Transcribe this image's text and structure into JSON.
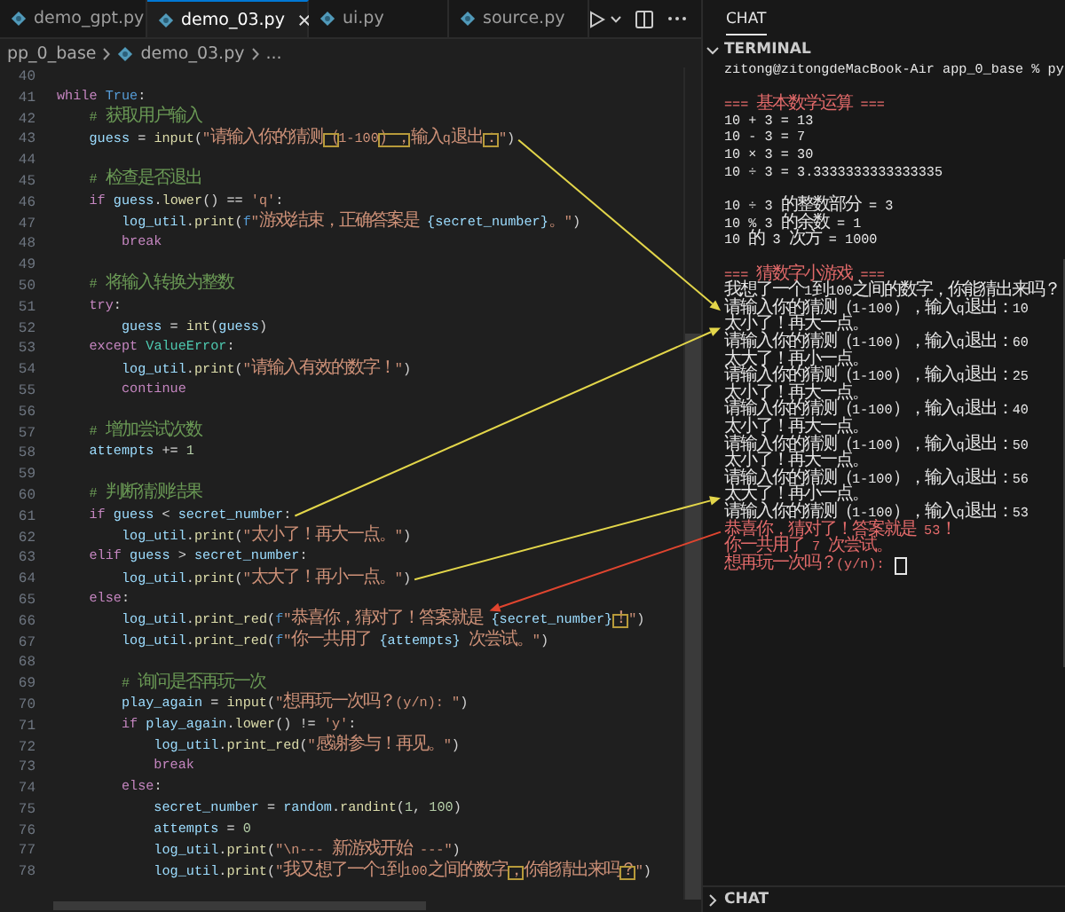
{
  "editor": {
    "tabs": [
      {
        "label": "demo_gpt.py",
        "selected": false
      },
      {
        "label": "demo_03.py",
        "selected": true
      },
      {
        "label": "ui.py",
        "selected": false
      },
      {
        "label": "source.py",
        "selected": false
      }
    ],
    "breadcrumb": [
      {
        "kind": "folder",
        "text": "pp_0_base"
      },
      {
        "kind": "file",
        "text": "demo_03.py"
      },
      {
        "kind": "more",
        "text": "..."
      }
    ],
    "lines": [
      {
        "number": "40"
      },
      {
        "number": "41",
        "tokens": [
          {
            "text": "while ",
            "kind": "keyword"
          },
          {
            "text": "True",
            "kind": "constant"
          },
          {
            "text": ":",
            "kind": "punct"
          }
        ]
      },
      {
        "number": "42",
        "tokens": [
          {
            "text": "    # 获取用户输入",
            "kind": "comment"
          }
        ]
      },
      {
        "number": "43",
        "tokens": [
          {
            "text": "    guess",
            "kind": "variable"
          },
          {
            "text": " = ",
            "kind": "punct"
          },
          {
            "text": "input",
            "kind": "function"
          },
          {
            "text": "(",
            "kind": "punct"
          },
          {
            "text": "\"请输入你的猜测",
            "kind": "string"
          },
          {
            "text": "（",
            "kind": "box"
          },
          {
            "text": "1-100",
            "kind": "string"
          },
          {
            "text": "），",
            "kind": "box"
          },
          {
            "text": "输入q退出",
            "kind": "string"
          },
          {
            "text": "：",
            "kind": "box"
          },
          {
            "text": "\"",
            "kind": "string"
          },
          {
            "text": ")",
            "kind": "punct"
          }
        ]
      },
      {
        "number": "44"
      },
      {
        "number": "45",
        "tokens": [
          {
            "text": "    # 检查是否退出",
            "kind": "comment"
          }
        ]
      },
      {
        "number": "46",
        "tokens": [
          {
            "text": "    if ",
            "kind": "keyword"
          },
          {
            "text": "guess",
            "kind": "variable"
          },
          {
            "text": ".",
            "kind": "punct"
          },
          {
            "text": "lower",
            "kind": "function"
          },
          {
            "text": "() == ",
            "kind": "punct"
          },
          {
            "text": "'q'",
            "kind": "string"
          },
          {
            "text": ":",
            "kind": "punct"
          }
        ]
      },
      {
        "number": "47",
        "tokens": [
          {
            "text": "        log_util",
            "kind": "variable"
          },
          {
            "text": ".",
            "kind": "punct"
          },
          {
            "text": "print",
            "kind": "function"
          },
          {
            "text": "(",
            "kind": "punct"
          },
          {
            "text": "f",
            "kind": "constant"
          },
          {
            "text": "\"游戏结束，正确答案是 ",
            "kind": "string"
          },
          {
            "text": "{secret_number}",
            "kind": "interp"
          },
          {
            "text": "。\"",
            "kind": "string"
          },
          {
            "text": ")",
            "kind": "punct"
          }
        ]
      },
      {
        "number": "48",
        "tokens": [
          {
            "text": "        break",
            "kind": "keyword"
          }
        ]
      },
      {
        "number": "49"
      },
      {
        "number": "50",
        "tokens": [
          {
            "text": "    # 将输入转换为整数",
            "kind": "comment"
          }
        ]
      },
      {
        "number": "51",
        "tokens": [
          {
            "text": "    try",
            "kind": "keyword"
          },
          {
            "text": ":",
            "kind": "punct"
          }
        ]
      },
      {
        "number": "52",
        "tokens": [
          {
            "text": "        guess",
            "kind": "variable"
          },
          {
            "text": " = ",
            "kind": "punct"
          },
          {
            "text": "int",
            "kind": "function"
          },
          {
            "text": "(",
            "kind": "punct"
          },
          {
            "text": "guess",
            "kind": "variable"
          },
          {
            "text": ")",
            "kind": "punct"
          }
        ]
      },
      {
        "number": "53",
        "tokens": [
          {
            "text": "    except ",
            "kind": "keyword"
          },
          {
            "text": "ValueError",
            "kind": "class"
          },
          {
            "text": ":",
            "kind": "punct"
          }
        ]
      },
      {
        "number": "54",
        "tokens": [
          {
            "text": "        log_util",
            "kind": "variable"
          },
          {
            "text": ".",
            "kind": "punct"
          },
          {
            "text": "print",
            "kind": "function"
          },
          {
            "text": "(",
            "kind": "punct"
          },
          {
            "text": "\"请输入有效的数字！\"",
            "kind": "string"
          },
          {
            "text": ")",
            "kind": "punct"
          }
        ]
      },
      {
        "number": "55",
        "tokens": [
          {
            "text": "        continue",
            "kind": "keyword"
          }
        ]
      },
      {
        "number": "56"
      },
      {
        "number": "57",
        "tokens": [
          {
            "text": "    # 增加尝试次数",
            "kind": "comment"
          }
        ]
      },
      {
        "number": "58",
        "tokens": [
          {
            "text": "    attempts",
            "kind": "variable"
          },
          {
            "text": " += ",
            "kind": "punct"
          },
          {
            "text": "1",
            "kind": "number"
          }
        ]
      },
      {
        "number": "59"
      },
      {
        "number": "60",
        "tokens": [
          {
            "text": "    # 判断猜测结果",
            "kind": "comment"
          }
        ]
      },
      {
        "number": "61",
        "tokens": [
          {
            "text": "    if ",
            "kind": "keyword"
          },
          {
            "text": "guess",
            "kind": "variable"
          },
          {
            "text": " < ",
            "kind": "punct"
          },
          {
            "text": "secret_number",
            "kind": "variable"
          },
          {
            "text": ":",
            "kind": "punct"
          }
        ]
      },
      {
        "number": "62",
        "tokens": [
          {
            "text": "        log_util",
            "kind": "variable"
          },
          {
            "text": ".",
            "kind": "punct"
          },
          {
            "text": "print",
            "kind": "function"
          },
          {
            "text": "(",
            "kind": "punct"
          },
          {
            "text": "\"太小了！再大一点。\"",
            "kind": "string"
          },
          {
            "text": ")",
            "kind": "punct"
          }
        ]
      },
      {
        "number": "63",
        "tokens": [
          {
            "text": "    elif ",
            "kind": "keyword"
          },
          {
            "text": "guess",
            "kind": "variable"
          },
          {
            "text": " > ",
            "kind": "punct"
          },
          {
            "text": "secret_number",
            "kind": "variable"
          },
          {
            "text": ":",
            "kind": "punct"
          }
        ]
      },
      {
        "number": "64",
        "tokens": [
          {
            "text": "        log_util",
            "kind": "variable"
          },
          {
            "text": ".",
            "kind": "punct"
          },
          {
            "text": "print",
            "kind": "function"
          },
          {
            "text": "(",
            "kind": "punct"
          },
          {
            "text": "\"太大了！再小一点。\"",
            "kind": "string"
          },
          {
            "text": ")",
            "kind": "punct"
          }
        ]
      },
      {
        "number": "65",
        "tokens": [
          {
            "text": "    else",
            "kind": "keyword"
          },
          {
            "text": ":",
            "kind": "punct"
          }
        ]
      },
      {
        "number": "66",
        "tokens": [
          {
            "text": "        log_util",
            "kind": "variable"
          },
          {
            "text": ".",
            "kind": "punct"
          },
          {
            "text": "print_red",
            "kind": "function"
          },
          {
            "text": "(",
            "kind": "punct"
          },
          {
            "text": "f",
            "kind": "constant"
          },
          {
            "text": "\"恭喜你，猜对了！答案就是 ",
            "kind": "string"
          },
          {
            "text": "{secret_number}",
            "kind": "interp"
          },
          {
            "text": "！",
            "kind": "box"
          },
          {
            "text": "\"",
            "kind": "string"
          },
          {
            "text": ")",
            "kind": "punct"
          }
        ]
      },
      {
        "number": "67",
        "tokens": [
          {
            "text": "        log_util",
            "kind": "variable"
          },
          {
            "text": ".",
            "kind": "punct"
          },
          {
            "text": "print_red",
            "kind": "function"
          },
          {
            "text": "(",
            "kind": "punct"
          },
          {
            "text": "f",
            "kind": "constant"
          },
          {
            "text": "\"你一共用了 ",
            "kind": "string"
          },
          {
            "text": "{attempts}",
            "kind": "interp"
          },
          {
            "text": " 次尝试。\"",
            "kind": "string"
          },
          {
            "text": ")",
            "kind": "punct"
          }
        ]
      },
      {
        "number": "68"
      },
      {
        "number": "69",
        "tokens": [
          {
            "text": "        # 询问是否再玩一次",
            "kind": "comment"
          }
        ]
      },
      {
        "number": "70",
        "tokens": [
          {
            "text": "        play_again",
            "kind": "variable"
          },
          {
            "text": " = ",
            "kind": "punct"
          },
          {
            "text": "input",
            "kind": "function"
          },
          {
            "text": "(",
            "kind": "punct"
          },
          {
            "text": "\"想再玩一次吗？(y/n): \"",
            "kind": "string"
          },
          {
            "text": ")",
            "kind": "punct"
          }
        ]
      },
      {
        "number": "71",
        "tokens": [
          {
            "text": "        if ",
            "kind": "keyword"
          },
          {
            "text": "play_again",
            "kind": "variable"
          },
          {
            "text": ".",
            "kind": "punct"
          },
          {
            "text": "lower",
            "kind": "function"
          },
          {
            "text": "() != ",
            "kind": "punct"
          },
          {
            "text": "'y'",
            "kind": "string"
          },
          {
            "text": ":",
            "kind": "punct"
          }
        ]
      },
      {
        "number": "72",
        "tokens": [
          {
            "text": "            log_util",
            "kind": "variable"
          },
          {
            "text": ".",
            "kind": "punct"
          },
          {
            "text": "print_red",
            "kind": "function"
          },
          {
            "text": "(",
            "kind": "punct"
          },
          {
            "text": "\"感谢参与！再见。\"",
            "kind": "string"
          },
          {
            "text": ")",
            "kind": "punct"
          }
        ]
      },
      {
        "number": "73",
        "tokens": [
          {
            "text": "            break",
            "kind": "keyword"
          }
        ]
      },
      {
        "number": "74",
        "tokens": [
          {
            "text": "        else",
            "kind": "keyword"
          },
          {
            "text": ":",
            "kind": "punct"
          }
        ]
      },
      {
        "number": "75",
        "tokens": [
          {
            "text": "            secret_number",
            "kind": "variable"
          },
          {
            "text": " = ",
            "kind": "punct"
          },
          {
            "text": "random",
            "kind": "variable"
          },
          {
            "text": ".",
            "kind": "punct"
          },
          {
            "text": "randint",
            "kind": "function"
          },
          {
            "text": "(",
            "kind": "punct"
          },
          {
            "text": "1",
            "kind": "number"
          },
          {
            "text": ", ",
            "kind": "punct"
          },
          {
            "text": "100",
            "kind": "number"
          },
          {
            "text": ")",
            "kind": "punct"
          }
        ]
      },
      {
        "number": "76",
        "tokens": [
          {
            "text": "            attempts",
            "kind": "variable"
          },
          {
            "text": " = ",
            "kind": "punct"
          },
          {
            "text": "0",
            "kind": "number"
          }
        ]
      },
      {
        "number": "77",
        "tokens": [
          {
            "text": "            log_util",
            "kind": "variable"
          },
          {
            "text": ".",
            "kind": "punct"
          },
          {
            "text": "print",
            "kind": "function"
          },
          {
            "text": "(",
            "kind": "punct"
          },
          {
            "text": "\"\\n--- 新游戏开始 ---\"",
            "kind": "string"
          },
          {
            "text": ")",
            "kind": "punct"
          }
        ]
      },
      {
        "number": "78",
        "tokens": [
          {
            "text": "            log_util",
            "kind": "variable"
          },
          {
            "text": ".",
            "kind": "punct"
          },
          {
            "text": "print",
            "kind": "function"
          },
          {
            "text": "(",
            "kind": "punct"
          },
          {
            "text": "\"我又想了一个1到100之间的数字",
            "kind": "string"
          },
          {
            "text": "，",
            "kind": "box"
          },
          {
            "text": "你能猜出来吗",
            "kind": "string"
          },
          {
            "text": "？",
            "kind": "box"
          },
          {
            "text": "\"",
            "kind": "string"
          },
          {
            "text": ")",
            "kind": "punct"
          }
        ]
      }
    ]
  },
  "panel": {
    "tabs": [
      {
        "label": "CHAT",
        "selected": true
      }
    ],
    "terminal": {
      "title": "TERMINAL",
      "expanded": true,
      "cursor": true,
      "lines": [
        {
          "kind": "normal",
          "text": "zitong@zitongdeMacBook-Air app_0_base % py"
        },
        {
          "kind": "blank"
        },
        {
          "kind": "red",
          "text": "=== 基本数学运算 ==="
        },
        {
          "kind": "normal",
          "text": "10 + 3 = 13"
        },
        {
          "kind": "normal",
          "text": "10 - 3 = 7"
        },
        {
          "kind": "normal",
          "text": "10 × 3 = 30"
        },
        {
          "kind": "normal",
          "text": "10 ÷ 3 = 3.3333333333333335"
        },
        {
          "kind": "blank"
        },
        {
          "kind": "normal",
          "text": "10 ÷ 3 的整数部分 = 3"
        },
        {
          "kind": "normal",
          "text": "10 % 3 的余数 = 1"
        },
        {
          "kind": "normal",
          "text": "10 的 3 次方 = 1000"
        },
        {
          "kind": "blank"
        },
        {
          "kind": "red",
          "text": "=== 猜数字小游戏 ==="
        },
        {
          "kind": "normal",
          "text": "我想了一个1到100之间的数字，你能猜出来吗？"
        },
        {
          "kind": "normal",
          "text": "请输入你的猜测（1-100），输入q退出：10"
        },
        {
          "kind": "normal",
          "text": "太小了！再大一点。"
        },
        {
          "kind": "normal",
          "text": "请输入你的猜测（1-100），输入q退出：60"
        },
        {
          "kind": "normal",
          "text": "太大了！再小一点。"
        },
        {
          "kind": "normal",
          "text": "请输入你的猜测（1-100），输入q退出：25"
        },
        {
          "kind": "normal",
          "text": "太小了！再大一点。"
        },
        {
          "kind": "normal",
          "text": "请输入你的猜测（1-100），输入q退出：40"
        },
        {
          "kind": "normal",
          "text": "太小了！再大一点。"
        },
        {
          "kind": "normal",
          "text": "请输入你的猜测（1-100），输入q退出：50"
        },
        {
          "kind": "normal",
          "text": "太小了！再大一点。"
        },
        {
          "kind": "normal",
          "text": "请输入你的猜测（1-100），输入q退出：56"
        },
        {
          "kind": "normal",
          "text": "太大了！再小一点。"
        },
        {
          "kind": "normal",
          "text": "请输入你的猜测（1-100），输入q退出：53"
        },
        {
          "kind": "red",
          "text": "恭喜你，猜对了！答案就是 53！"
        },
        {
          "kind": "red",
          "text": "你一共用了 7 次尝试。"
        },
        {
          "kind": "red",
          "text": "想再玩一次吗？(y/n): "
        }
      ]
    },
    "collapsed_section": {
      "title": "CHAT",
      "expanded": false
    }
  }
}
